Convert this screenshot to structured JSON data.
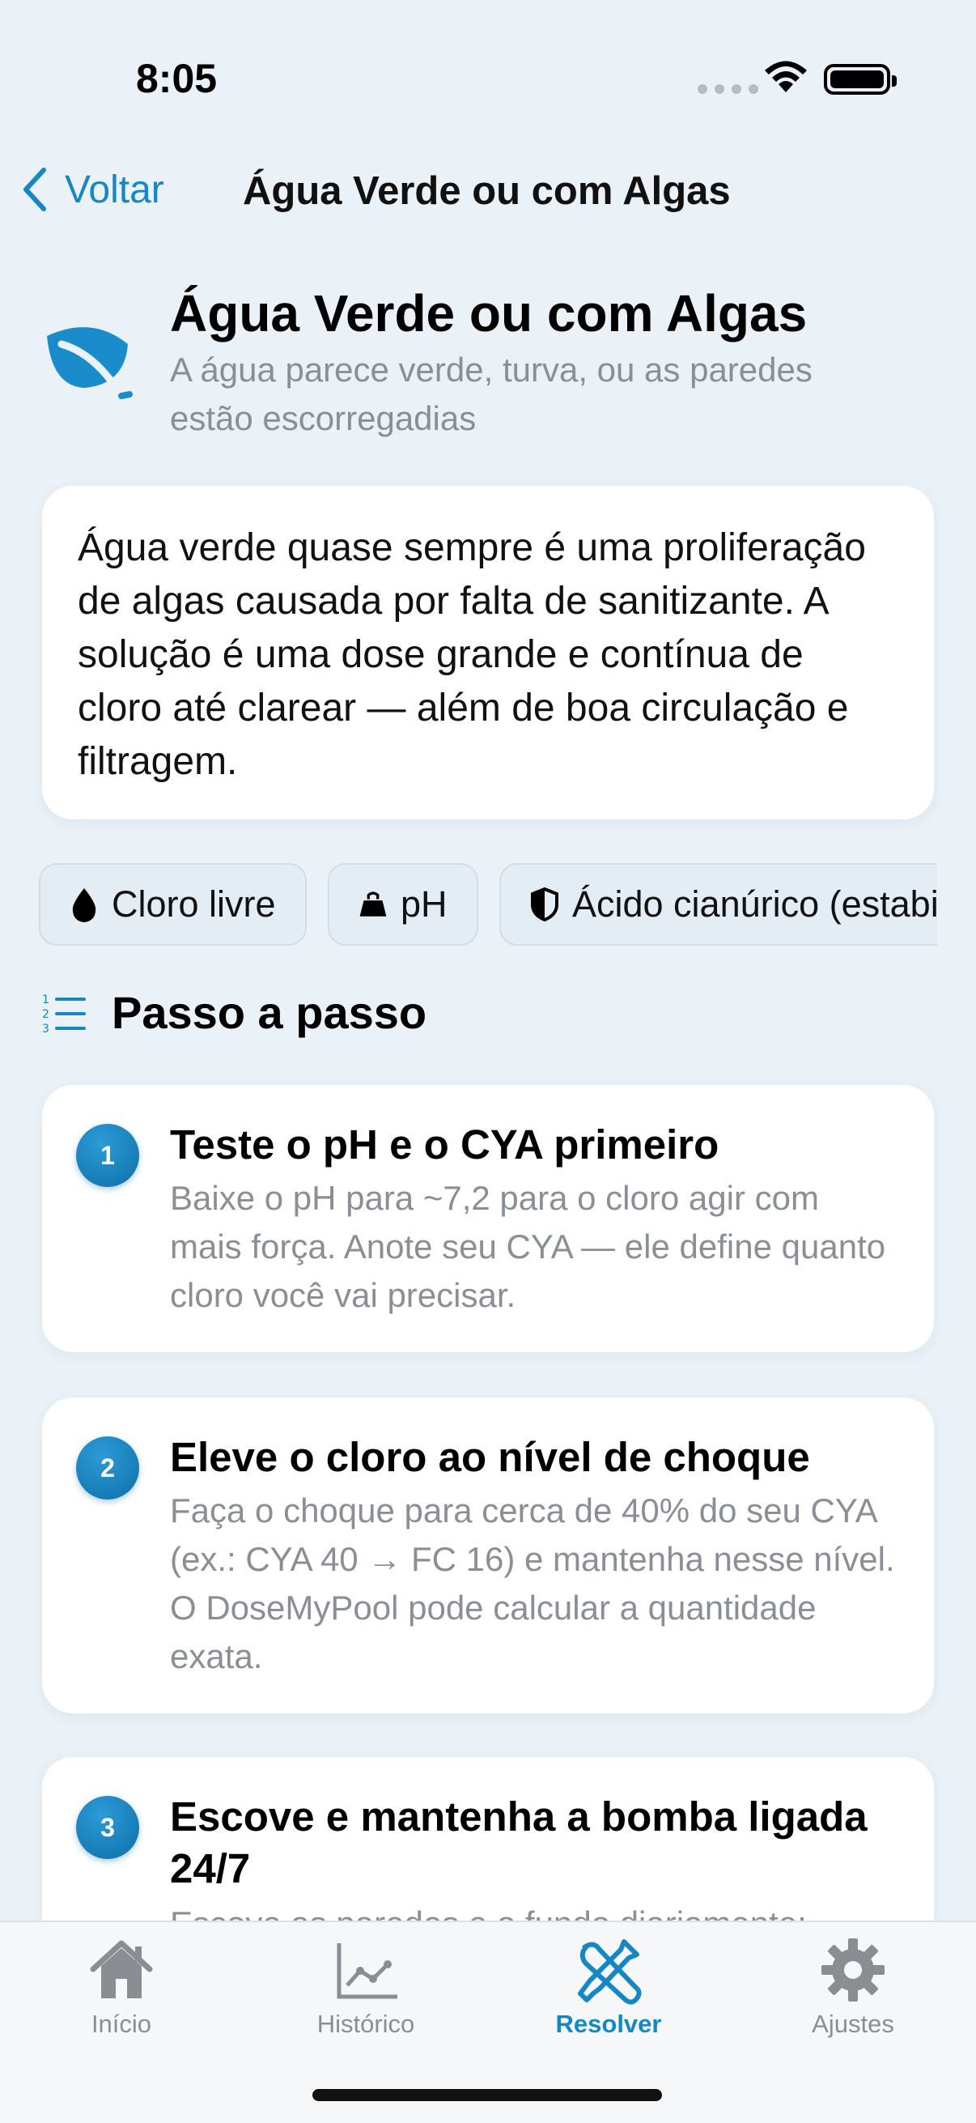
{
  "status_bar": {
    "time": "8:05"
  },
  "nav": {
    "back_label": "Voltar",
    "title": "Água Verde ou com Algas"
  },
  "hero": {
    "icon": "leaf-icon",
    "title": "Água Verde ou com Algas",
    "subtitle": "A água parece verde, turva, ou as paredes estão escorregadias"
  },
  "intro": "Água verde quase sempre é uma proliferação de algas causada por falta de sanitizante. A solução é uma dose grande e contínua de cloro até clarear — além de boa circulação e filtragem.",
  "chips": [
    {
      "label": "Cloro livre",
      "icon": "drop-icon"
    },
    {
      "label": "pH",
      "icon": "kettlebell-icon"
    },
    {
      "label": "Ácido cianúrico (estabilizante)",
      "icon": "shield-icon"
    }
  ],
  "section": {
    "title": "Passo a passo",
    "icon": "numbered-list-icon"
  },
  "steps": [
    {
      "number": "1",
      "title": "Teste o pH e o CYA primeiro",
      "description": "Baixe o pH para ~7,2 para o cloro agir com mais força. Anote seu CYA — ele define quanto cloro você vai precisar."
    },
    {
      "number": "2",
      "title": "Eleve o cloro ao nível de choque",
      "description": "Faça o choque para cerca de 40% do seu CYA (ex.: CYA 40 → FC 16) e mantenha nesse nível. O DoseMyPool pode calcular a quantidade exata."
    },
    {
      "number": "3",
      "title": "Escove e mantenha a bomba ligada 24/7",
      "description": "Escove as paredes e o fundo diariamente;"
    }
  ],
  "tabbar": {
    "tabs": [
      {
        "label": "Início",
        "icon": "house-icon"
      },
      {
        "label": "Histórico",
        "icon": "chart-icon"
      },
      {
        "label": "Resolver",
        "icon": "wrench-screwdriver-icon",
        "active": true
      },
      {
        "label": "Ajustes",
        "icon": "gear-icon"
      }
    ]
  },
  "colors": {
    "accent": "#1588c4",
    "background": "#eaf1f7",
    "muted_text": "#8a8f95"
  }
}
